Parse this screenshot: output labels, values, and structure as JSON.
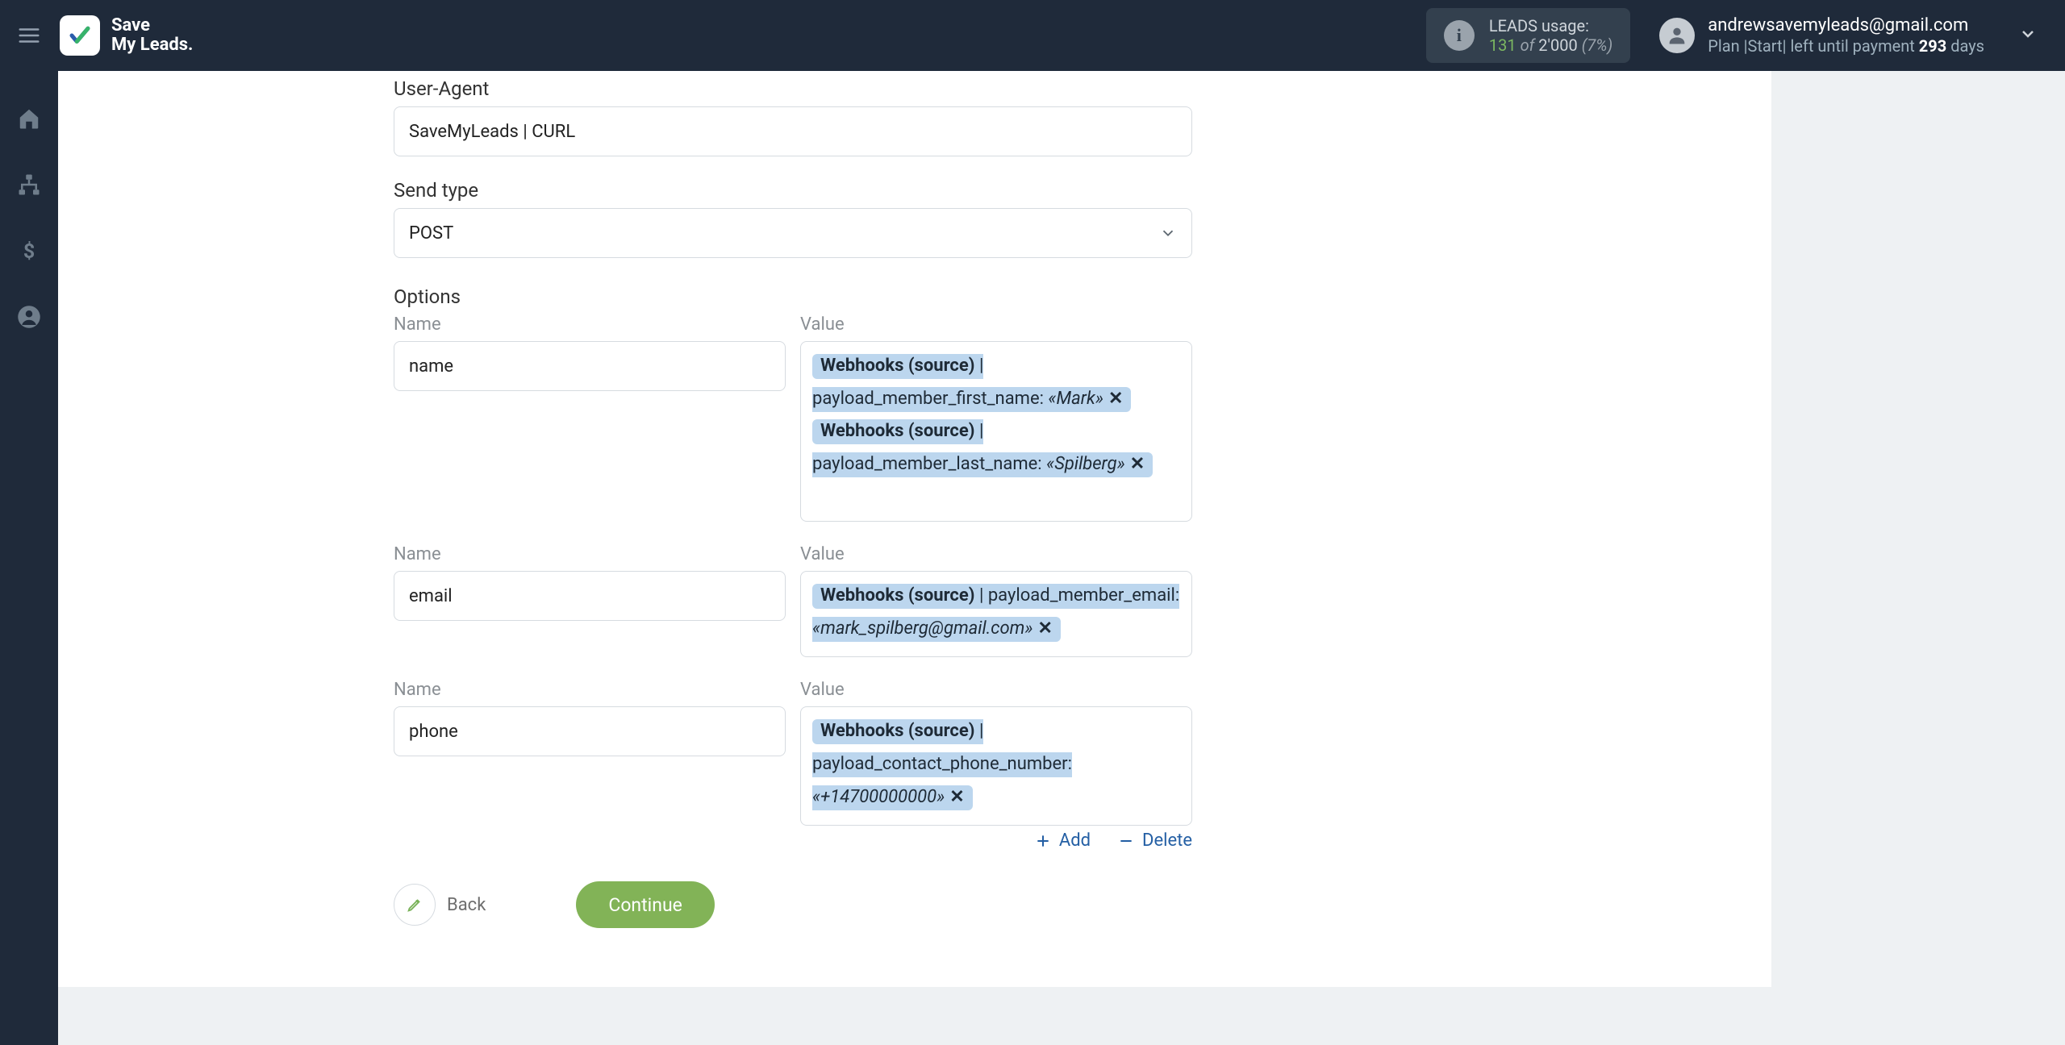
{
  "brand": {
    "line1": "Save",
    "line2": "My Leads."
  },
  "usage": {
    "title": "LEADS usage:",
    "used": "131",
    "of_word": "of",
    "total": "2'000",
    "pct": "(7%)"
  },
  "account": {
    "email": "andrewsavemyleads@gmail.com",
    "plan_prefix": "Plan |Start| left until payment ",
    "plan_days": "293",
    "plan_suffix": " days"
  },
  "labels": {
    "user_agent": "User-Agent",
    "send_type": "Send type",
    "options": "Options",
    "name": "Name",
    "value": "Value",
    "add": "Add",
    "delete": "Delete",
    "back": "Back",
    "continue": "Continue"
  },
  "fields": {
    "user_agent_value": "SaveMyLeads | CURL",
    "send_type_value": "POST"
  },
  "options": [
    {
      "name": "name",
      "tags": [
        {
          "source": "Webhooks (source)",
          "sep": " | ",
          "path": "payload_member_first_name:",
          "sample": "«Mark»"
        },
        {
          "source": "Webhooks (source)",
          "sep": " | ",
          "path": "payload_member_last_name:",
          "sample": "«Spilberg»"
        }
      ]
    },
    {
      "name": "email",
      "tags": [
        {
          "source": "Webhooks (source)",
          "sep": " | ",
          "path": "payload_member_email:",
          "sample": "«mark_spilberg@gmail.com»"
        }
      ]
    },
    {
      "name": "phone",
      "tags": [
        {
          "source": "Webhooks (source)",
          "sep": " | ",
          "path": "payload_contact_phone_number:",
          "sample": "«+14700000000»"
        }
      ]
    }
  ]
}
